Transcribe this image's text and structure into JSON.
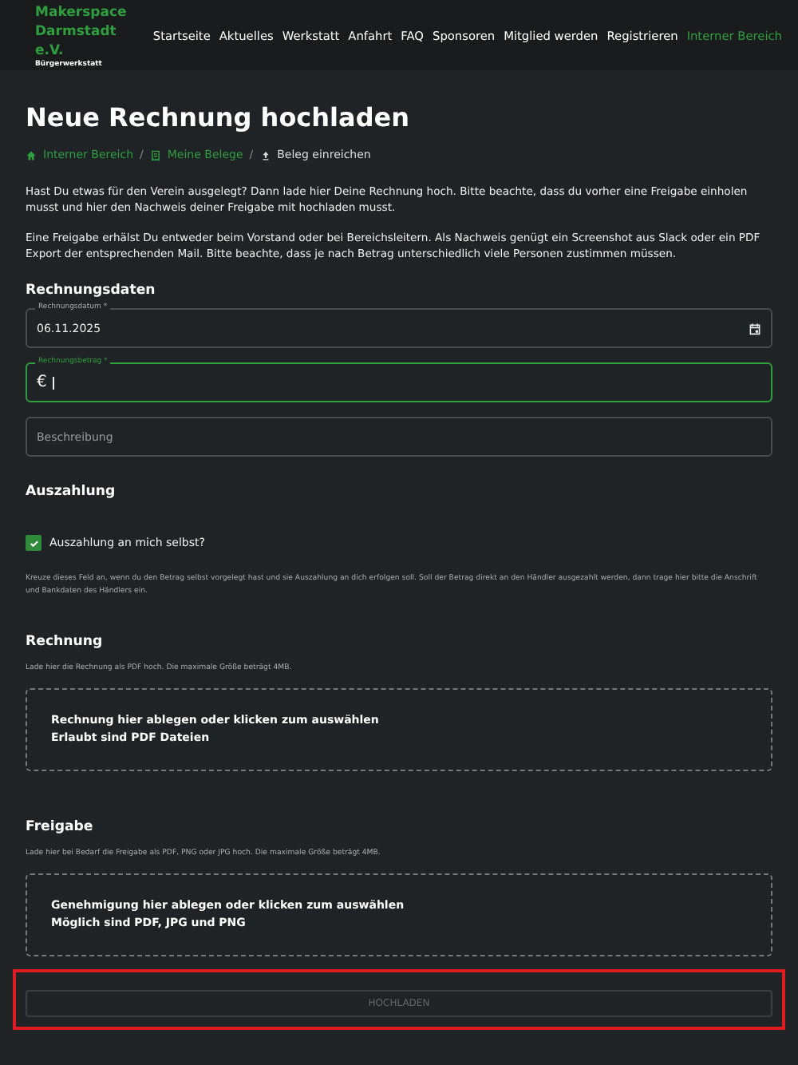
{
  "header": {
    "brand": "Makerspace Darmstadt e.V.",
    "tagline": "Bürgerwerkstatt",
    "nav": [
      {
        "label": "Startseite",
        "selected": false
      },
      {
        "label": "Aktuelles",
        "selected": false
      },
      {
        "label": "Werkstatt",
        "selected": false
      },
      {
        "label": "Anfahrt",
        "selected": false
      },
      {
        "label": "FAQ",
        "selected": false
      },
      {
        "label": "Sponsoren",
        "selected": false
      },
      {
        "label": "Mitglied werden",
        "selected": false
      },
      {
        "label": "Registrieren",
        "selected": false
      },
      {
        "label": "Interner Bereich",
        "selected": true
      }
    ]
  },
  "title": "Neue Rechnung hochladen",
  "breadcrumb_separator": "/",
  "breadcrumb": [
    {
      "label": "Interner Bereich",
      "current": false
    },
    {
      "label": "Meine Belege",
      "current": false
    },
    {
      "label": "Beleg einreichen",
      "current": true
    }
  ],
  "intro": [
    "Hast Du etwas für den Verein ausgelegt? Dann lade hier Deine Rechnung hoch. Bitte beachte, dass du vorher eine Freigabe einholen musst und hier den Nachweis deiner Freigabe mit hochladen musst.",
    "Eine Freigabe erhälst Du entweder beim Vorstand oder bei Bereichsleitern. Als Nachweis genügt ein Screenshot aus Slack oder ein PDF Export der entsprechenden Mail. Bitte beachte, dass je nach Betrag unterschiedlich viele Personen zustimmen müssen."
  ],
  "invoice_data": {
    "heading": "Rechnungsdaten",
    "fields": [
      {
        "kind": "date",
        "label": "Rechnungsdatum *",
        "value": "06.11.2025",
        "focused": false
      },
      {
        "kind": "amount",
        "label": "Rechnungsbetrag *",
        "prefix": "€",
        "focused": true
      },
      {
        "kind": "text",
        "placeholder": "Beschreibung",
        "focused": false
      }
    ]
  },
  "payout": {
    "heading": "Auszahlung",
    "checkbox": {
      "label": "Auszahlung an mich selbst?",
      "checked": true
    },
    "help": "Kreuze dieses Feld an, wenn du den Betrag selbst vorgelegt hast und sie Auszahlung an dich erfolgen soll. Soll der Betrag direkt an den Händler ausgezahlt werden, dann trage hier bitte die Anschrift und Bankdaten des Händlers ein."
  },
  "uploads": [
    {
      "heading": "Rechnung",
      "help": "Lade hier die Rechnung als PDF hoch. Die maximale Größe beträgt 4MB.",
      "drop_text": "Rechnung hier ablegen oder klicken zum auswählen",
      "drop_hint": "Erlaubt sind PDF Dateien"
    },
    {
      "heading": "Freigabe",
      "help": "Lade hier bei Bedarf die Freigabe als PDF, PNG oder JPG hoch. Die maximale Größe beträgt 4MB.",
      "drop_text": "Genehmigung hier ablegen oder klicken zum auswählen",
      "drop_hint": "Möglich sind PDF, JPG und PNG"
    }
  ],
  "submit": {
    "label": "HOCHLADEN",
    "disabled": true,
    "highlighted": true
  }
}
